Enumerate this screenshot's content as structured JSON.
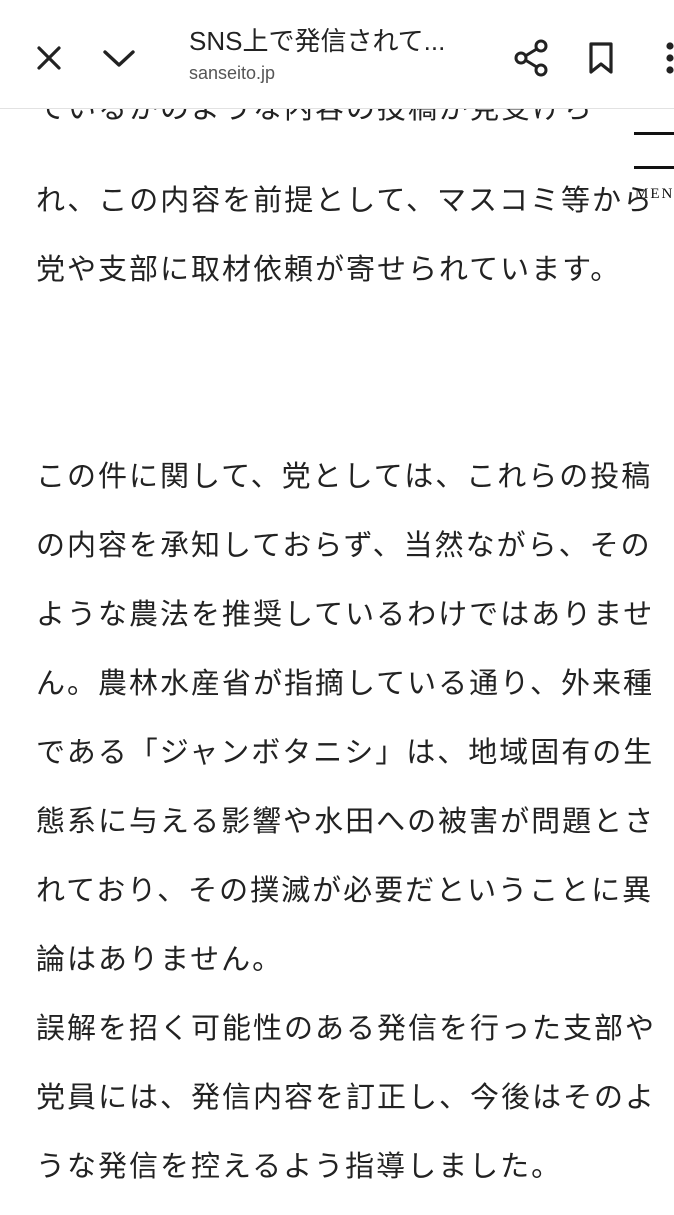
{
  "browser": {
    "page_title": "SNS上で発信されて...",
    "url": "sanseito.jp",
    "icons": {
      "close": "close-icon",
      "collapse": "chevron-down-icon",
      "share": "share-icon",
      "bookmark": "bookmark-icon",
      "more": "more-vert-icon"
    }
  },
  "menu": {
    "label": "MENU"
  },
  "article": {
    "cut_line": "ているかのような内容の投稿が見受けら",
    "paragraph1": "れ、この内容を前提として、マスコミ等から党や支部に取材依頼が寄せられています。",
    "paragraph2": "この件に関して、党としては、これらの投稿の内容を承知しておらず、当然ながら、そのような農法を推奨しているわけではありません。農林水産省が指摘している通り、外来種である「ジャンボタニシ」は、地域固有の生態系に与える影響や水田への被害が問題とされており、その撲滅が必要だということに異論はありません。",
    "paragraph3": "誤解を招く可能性のある発信を行った支部や党員には、発信内容を訂正し、今後はそのような発信を控えるよう指導しました。"
  }
}
